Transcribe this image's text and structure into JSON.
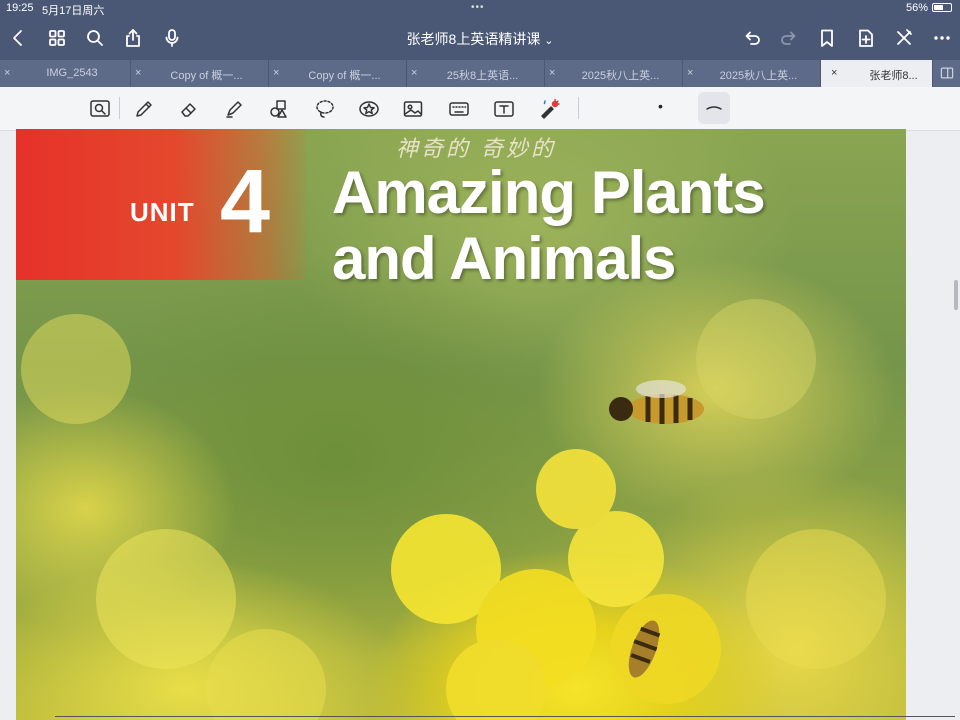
{
  "status_bar": {
    "time": "19:25",
    "date": "5月17日周六",
    "battery": "56%",
    "battery_level": 0.56
  },
  "nav": {
    "title": "张老师8上英语精讲课",
    "title_chevron": "⌄"
  },
  "tabs": [
    {
      "label": "IMG_2543",
      "close": "×"
    },
    {
      "label": "Copy of 概一...",
      "close": "×"
    },
    {
      "label": "Copy of 概一...",
      "close": "×"
    },
    {
      "label": "25秋8上英语...",
      "close": "×"
    },
    {
      "label": "2025秋八上英...",
      "close": "×"
    },
    {
      "label": "2025秋八上英...",
      "close": "×"
    },
    {
      "label": "张老师8...",
      "close": "×",
      "active": true
    }
  ],
  "toolbar": {
    "tools": [
      "lasso-zoom-icon",
      "pen-icon",
      "eraser-icon",
      "highlighter-icon",
      "shapes-icon",
      "lasso-icon",
      "sticker-icon",
      "image-icon",
      "keyboard-icon",
      "text-box-icon",
      "laser-pointer-icon"
    ],
    "pen_dot": "•"
  },
  "document": {
    "unit_word": "UNIT",
    "unit_number": "4",
    "title_line1": "Amazing Plants",
    "title_line2": "and Animals",
    "handwritten_note": "神奇的 奇妙的"
  },
  "colors": {
    "nav_bg": "#4a5876",
    "tab_bg": "#5d6b88",
    "unit_red": "#e6312a"
  }
}
